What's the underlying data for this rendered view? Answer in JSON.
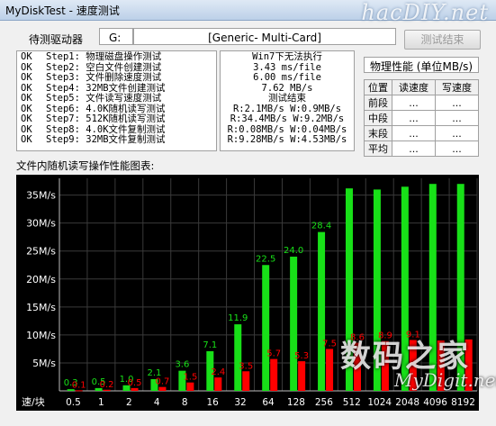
{
  "window": {
    "title": "MyDiskTest - 速度测试"
  },
  "watermark_top": "hacDIY.net",
  "watermark_bottom": "数码之家",
  "watermark_bottom_url": "MyDigit.net",
  "drive_row": {
    "label": "待测驱动器",
    "letter": "G:",
    "device": "[Generic- Multi-Card]",
    "end_button": "测试结束"
  },
  "steps": [
    {
      "status": "OK",
      "text": "Step1: 物理磁盘操作测试"
    },
    {
      "status": "OK",
      "text": "Step2: 空白文件创建测试"
    },
    {
      "status": "OK",
      "text": "Step3: 文件删除速度测试"
    },
    {
      "status": "OK",
      "text": "Step4: 32MB文件创建测试"
    },
    {
      "status": "OK",
      "text": "Step5: 文件读写速度测试"
    },
    {
      "status": "OK",
      "text": "Step6: 4.0K随机读写测试"
    },
    {
      "status": "OK",
      "text": "Step7: 512K随机读写测试"
    },
    {
      "status": "OK",
      "text": "Step8: 4.0K文件复制测试"
    },
    {
      "status": "OK",
      "text": "Step9: 32MB文件复制测试"
    }
  ],
  "results": [
    "Win7下无法执行",
    "3.43 ms/file",
    "6.00 ms/file",
    "7.62 MB/s",
    "测试结束",
    "R:2.1MB/s W:0.9MB/s",
    "R:34.4MB/s W:9.2MB/s",
    "R:0.08MB/s W:0.04MB/s",
    "R:9.28MB/s W:4.53MB/s"
  ],
  "perf": {
    "title": "物理性能 (单位MB/s)",
    "headers": [
      "位置",
      "读速度",
      "写速度"
    ],
    "rows": [
      {
        "pos": "前段",
        "read": "...",
        "write": "..."
      },
      {
        "pos": "中段",
        "read": "...",
        "write": "..."
      },
      {
        "pos": "末段",
        "read": "...",
        "write": "..."
      },
      {
        "pos": "平均",
        "read": "...",
        "write": "..."
      }
    ]
  },
  "chart_caption": "文件内随机读写操作性能图表:",
  "chart_data": {
    "type": "bar",
    "title": "文件内随机读写操作性能图表:",
    "x_axis_label": "速/块",
    "categories": [
      "0.5",
      "1",
      "2",
      "4",
      "8",
      "16",
      "32",
      "64",
      "128",
      "256",
      "512",
      "1024",
      "2048",
      "4096",
      "8192"
    ],
    "series": [
      {
        "color": "#18e018",
        "values": [
          0.3,
          0.5,
          1.0,
          2.1,
          3.6,
          7.1,
          11.9,
          22.5,
          24.0,
          28.4,
          36.2,
          36.0,
          36.5,
          37.0,
          37.0
        ],
        "labels": [
          "0.3",
          "0.5",
          "1.0",
          "2.1",
          "3.6",
          "7.1",
          "11.9",
          "22.5",
          "24.0",
          "28.4",
          "",
          "",
          "",
          "",
          ""
        ]
      },
      {
        "color": "#ff0000",
        "values": [
          0.1,
          0.2,
          0.5,
          0.7,
          1.5,
          2.4,
          3.5,
          5.7,
          5.3,
          7.5,
          8.6,
          8.9,
          9.1,
          9.0,
          9.2
        ],
        "labels": [
          "0.1",
          "0.2",
          "0.5",
          "0.7",
          "1.5",
          "2.4",
          "3.5",
          "5.7",
          "5.3",
          "7.5",
          "8.6",
          "8.9",
          "9.1",
          "",
          ""
        ]
      }
    ],
    "ytick_labels": [
      "5M/s",
      "10M/s",
      "15M/s",
      "20M/s",
      "25M/s",
      "30M/s",
      "35M/s"
    ],
    "ytick_values": [
      5,
      10,
      15,
      20,
      25,
      30,
      35
    ],
    "ylim": [
      0,
      38
    ],
    "grid": true
  }
}
